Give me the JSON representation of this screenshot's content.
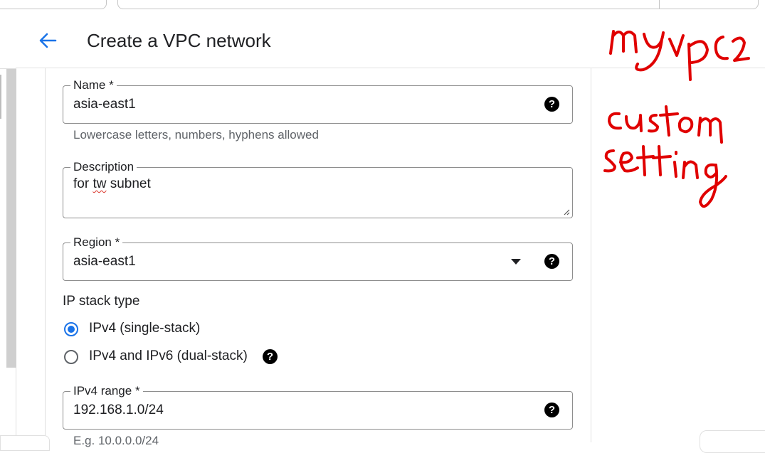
{
  "header": {
    "title": "Create a VPC network",
    "back_icon": "arrow-back-icon"
  },
  "form": {
    "name": {
      "label": "Name *",
      "value": "asia-east1",
      "hint": "Lowercase letters, numbers, hyphens allowed",
      "help_icon": "help-icon"
    },
    "description": {
      "label": "Description",
      "value_before": "for ",
      "value_misspelled": "tw",
      "value_after": " subnet"
    },
    "region": {
      "label": "Region *",
      "value": "asia-east1",
      "help_icon": "help-icon",
      "dropdown_icon": "dropdown-arrow-icon"
    },
    "ip_stack": {
      "heading": "IP stack type",
      "options": [
        {
          "label": "IPv4 (single-stack)",
          "selected": true
        },
        {
          "label": "IPv4 and IPv6 (dual-stack)",
          "selected": false
        }
      ],
      "help_icon": "help-icon"
    },
    "ipv4_range": {
      "label": "IPv4 range *",
      "value": "192.168.1.0/24",
      "hint": "E.g. 10.0.0.0/24",
      "help_icon": "help-icon"
    }
  },
  "colors": {
    "accent": "#1a73e8",
    "annotation": "#e00000",
    "hint_text": "#5f6368"
  }
}
